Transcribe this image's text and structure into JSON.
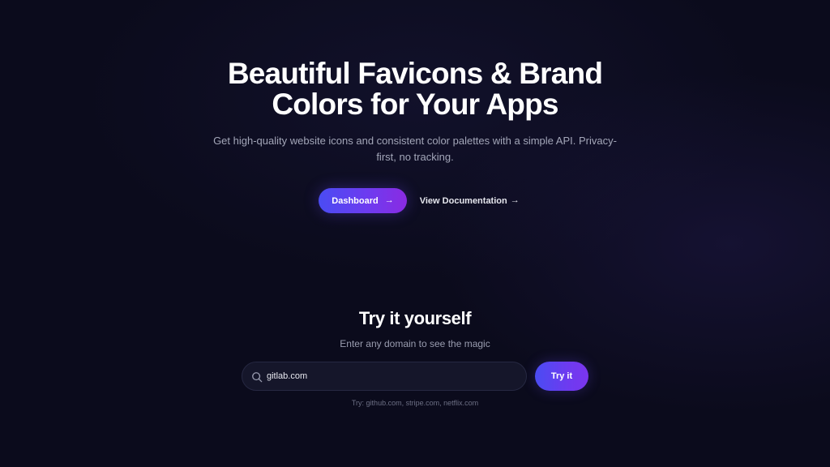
{
  "hero": {
    "title": "Beautiful Favicons & Brand Colors for Your Apps",
    "subtitle": "Get high-quality website icons and consistent color palettes with a simple API. Privacy-first, no tracking.",
    "primary_button_label": "Dashboard",
    "primary_button_icon": "arrow-right-icon",
    "secondary_button_label": "View Documentation",
    "secondary_button_icon": "arrow-right-icon"
  },
  "try": {
    "title": "Try it yourself",
    "subtitle": "Enter any domain to see the magic",
    "input_value": "gitlab.com",
    "input_icon": "search-icon",
    "button_label": "Try it",
    "hint": "Try: github.com, stripe.com, netflix.com"
  },
  "colors": {
    "background": "#0b0b1c",
    "accent_start": "#4a4cf2",
    "accent_end": "#8a2be2",
    "muted_text": "#a3a6b8",
    "input_bg": "#15162a"
  }
}
